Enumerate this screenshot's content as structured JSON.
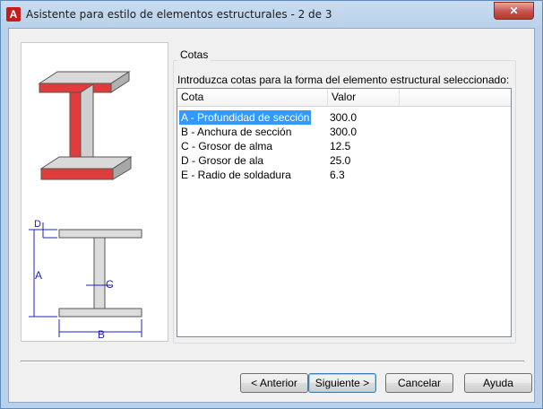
{
  "window": {
    "title": "Asistente para estilo de elementos estructurales - 2 de 3",
    "app_icon": "A",
    "close_glyph": "✕"
  },
  "group": {
    "title": "Cotas",
    "instruction": "Introduzca cotas para la forma del elemento estructural seleccionado:"
  },
  "list": {
    "columns": [
      "Cota",
      "Valor",
      ""
    ],
    "rows": [
      {
        "name": "A - Profundidad de sección",
        "value": "300.0"
      },
      {
        "name": "B - Anchura de sección",
        "value": "300.0"
      },
      {
        "name": "C - Grosor de alma",
        "value": "12.5"
      },
      {
        "name": "D - Grosor de ala",
        "value": "25.0"
      },
      {
        "name": "E - Radio de soldadura",
        "value": "6.3"
      }
    ],
    "selected_index": 0
  },
  "illustration": {
    "labels": {
      "a": "A",
      "b": "B",
      "c": "C",
      "d": "D"
    },
    "accent_color": "#e03c3c",
    "dim_color": "#2020c0"
  },
  "buttons": {
    "back": "< Anterior",
    "next": "Siguiente >",
    "cancel": "Cancelar",
    "help": "Ayuda"
  }
}
